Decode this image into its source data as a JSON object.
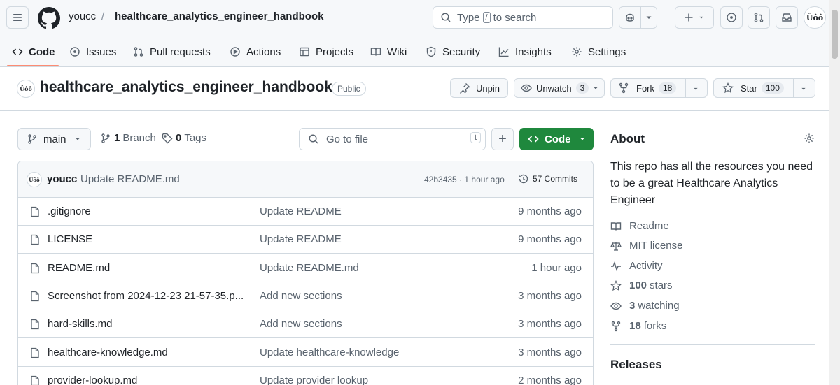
{
  "header": {
    "owner": "youcc",
    "separator": "/",
    "repo": "healthcare_analytics_engineer_handbook",
    "search": {
      "before": "Type",
      "key": "/",
      "after": "to search"
    },
    "avatar_text": "Ûôô"
  },
  "tabs": [
    {
      "label": "Code",
      "icon": "code-icon",
      "active": true
    },
    {
      "label": "Issues",
      "icon": "issue-icon"
    },
    {
      "label": "Pull requests",
      "icon": "pull-request-icon"
    },
    {
      "label": "Actions",
      "icon": "play-icon"
    },
    {
      "label": "Projects",
      "icon": "table-icon"
    },
    {
      "label": "Wiki",
      "icon": "book-icon"
    },
    {
      "label": "Security",
      "icon": "shield-icon"
    },
    {
      "label": "Insights",
      "icon": "graph-icon"
    },
    {
      "label": "Settings",
      "icon": "gear-icon"
    }
  ],
  "repo": {
    "title": "healthcare_analytics_engineer_handbook",
    "visibility": "Public",
    "unpin_label": "Unpin",
    "watch_label": "Unwatch",
    "watch_count": "3",
    "fork_label": "Fork",
    "fork_count": "18",
    "star_label": "Star",
    "star_count": "100"
  },
  "branchbar": {
    "branch": "main",
    "branch_count": "1",
    "branch_label": "Branch",
    "tag_count": "0",
    "tag_label": "Tags",
    "goto_placeholder": "Go to file",
    "goto_key": "t",
    "add_label": "+",
    "code_label": "Code"
  },
  "commit": {
    "user": "youcc",
    "message": "Update README.md",
    "sha_time": "42b3435 · 1 hour ago",
    "commits": "57 Commits"
  },
  "files": [
    {
      "name": ".gitignore",
      "message": "Update README",
      "time": "9 months ago"
    },
    {
      "name": "LICENSE",
      "message": "Update README",
      "time": "9 months ago"
    },
    {
      "name": "README.md",
      "message": "Update README.md",
      "time": "1 hour ago"
    },
    {
      "name": "Screenshot from 2024-12-23 21-57-35.p...",
      "message": "Add new sections",
      "time": "3 months ago"
    },
    {
      "name": "hard-skills.md",
      "message": "Add new sections",
      "time": "3 months ago"
    },
    {
      "name": "healthcare-knowledge.md",
      "message": "Update healthcare-knowledge",
      "time": "3 months ago"
    },
    {
      "name": "provider-lookup.md",
      "message": "Update provider lookup",
      "time": "2 months ago"
    }
  ],
  "about": {
    "title": "About",
    "description": "This repo has all the resources you need to be a great Healthcare Analytics Engineer",
    "readme": "Readme",
    "license": "MIT license",
    "activity": "Activity",
    "stars_count": "100",
    "stars_label": "stars",
    "watching_count": "3",
    "watching_label": "watching",
    "forks_count": "18",
    "forks_label": "forks",
    "releases": "Releases"
  },
  "colors": {
    "accent_green": "#1f883d",
    "tab_underline": "#fd8c73"
  }
}
